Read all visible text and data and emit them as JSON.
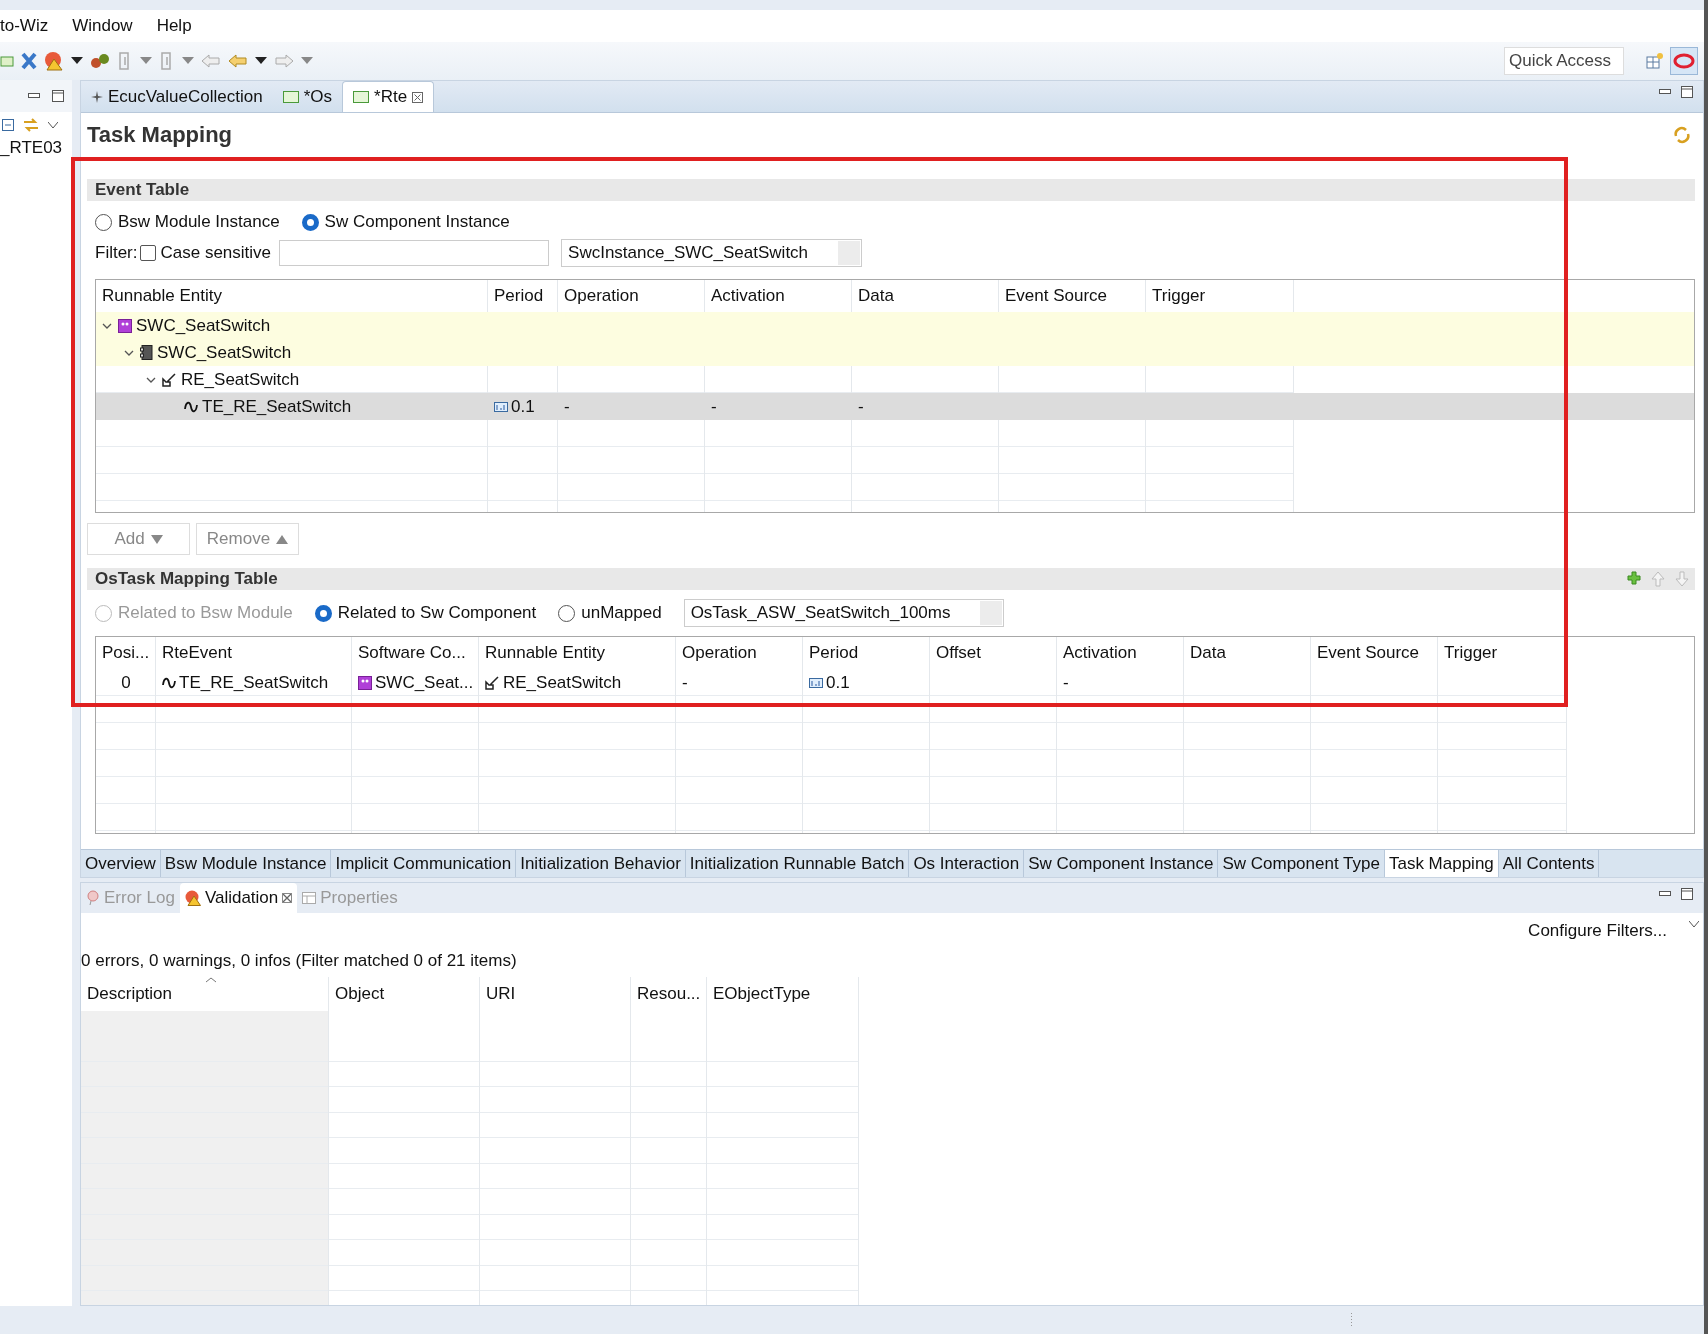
{
  "menu": [
    {
      "label": "to-Wiz"
    },
    {
      "label": "Window"
    },
    {
      "label": "Help"
    }
  ],
  "quick_access": {
    "placeholder": "Quick Access"
  },
  "left_panel": {
    "label": "_RTE03"
  },
  "editor_tabs": [
    {
      "label": "EcucValueCollection",
      "kind": "collection",
      "selected": false
    },
    {
      "label": "*Os",
      "kind": "config",
      "selected": false
    },
    {
      "label": "*Rte",
      "kind": "config",
      "selected": true
    }
  ],
  "page_title": "Task Mapping",
  "event_table": {
    "title": "Event Table",
    "scope": [
      {
        "label": "Bsw Module Instance",
        "selected": false
      },
      {
        "label": "Sw Component Instance",
        "selected": true
      }
    ],
    "filter": {
      "label": "Filter:",
      "case_sensitive": {
        "label": "Case sensitive",
        "checked": false
      }
    },
    "instance": "SwcInstance_SWC_SeatSwitch",
    "columns": [
      "Runnable Entity",
      "Period",
      "Operation",
      "Activation",
      "Data",
      "Event Source",
      "Trigger"
    ],
    "rows": [
      {
        "kind": "component",
        "label": "SWC_SeatSwitch",
        "expanded": true,
        "selected": false,
        "cells": [
          null,
          null,
          null,
          null,
          null,
          null
        ],
        "children": [
          {
            "kind": "swc-type",
            "label": "SWC_SeatSwitch",
            "expanded": true,
            "selected": false,
            "cells": [
              null,
              null,
              null,
              null,
              null,
              null
            ],
            "children": [
              {
                "kind": "runnable",
                "label": "RE_SeatSwitch",
                "expanded": true,
                "selected": false,
                "cells": [
                  null,
                  null,
                  null,
                  null,
                  null,
                  null
                ],
                "children": [
                  {
                    "kind": "timing-event",
                    "label": "TE_RE_SeatSwitch",
                    "selected": true,
                    "cells": [
                      {
                        "text": "0.1",
                        "kind": "period"
                      },
                      {
                        "text": "-"
                      },
                      {
                        "text": "-"
                      },
                      {
                        "text": "-"
                      },
                      null,
                      null
                    ]
                  }
                ]
              }
            ]
          }
        ]
      }
    ],
    "buttons": [
      {
        "label": "Add",
        "kind": "menu-down",
        "disabled": true
      },
      {
        "label": "Remove",
        "kind": "menu-up",
        "disabled": true
      }
    ]
  },
  "ostask_table": {
    "title": "OsTask Mapping Table",
    "scope": [
      {
        "label": "Related to Bsw Module",
        "selected": false,
        "disabled": true
      },
      {
        "label": "Related to Sw Component",
        "selected": true,
        "disabled": false
      },
      {
        "label": "unMapped",
        "selected": false,
        "disabled": false
      }
    ],
    "task": "OsTask_ASW_SeatSwitch_100ms",
    "columns": [
      "Posi...",
      "RteEvent",
      "Software Co...",
      "Runnable Entity",
      "Operation",
      "Period",
      "Offset",
      "Activation",
      "Data",
      "Event Source",
      "Trigger"
    ],
    "rows": [
      {
        "cells": [
          {
            "text": "0"
          },
          {
            "text": "TE_RE_SeatSwitch",
            "kind": "timing-event"
          },
          {
            "text": "SWC_Seat...",
            "kind": "component"
          },
          {
            "text": "RE_SeatSwitch",
            "kind": "runnable"
          },
          {
            "text": "-"
          },
          {
            "text": "0.1",
            "kind": "period"
          },
          null,
          {
            "text": "-"
          },
          null,
          null,
          null
        ]
      }
    ]
  },
  "page_tabs": [
    {
      "label": "Overview",
      "selected": false
    },
    {
      "label": "Bsw Module Instance",
      "selected": false
    },
    {
      "label": "Implicit Communication",
      "selected": false
    },
    {
      "label": "Initialization Behavior",
      "selected": false
    },
    {
      "label": "Initialization Runnable Batch",
      "selected": false
    },
    {
      "label": "Os Interaction",
      "selected": false
    },
    {
      "label": "Sw Component Instance",
      "selected": false
    },
    {
      "label": "Sw Component Type",
      "selected": false
    },
    {
      "label": "Task Mapping",
      "selected": true
    },
    {
      "label": "All Contents",
      "selected": false
    }
  ],
  "views": {
    "tabs": [
      {
        "label": "Error Log",
        "kind": "error-log",
        "selected": false
      },
      {
        "label": "Validation",
        "kind": "validation",
        "selected": true
      },
      {
        "label": "Properties",
        "kind": "properties",
        "selected": false
      }
    ],
    "action": "Configure Filters...",
    "summary": "0 errors, 0 warnings, 0 infos (Filter matched 0 of 21 items)",
    "columns": [
      {
        "label": "Description",
        "sorted": true
      },
      {
        "label": "Object",
        "sorted": false
      },
      {
        "label": "URI",
        "sorted": false
      },
      {
        "label": "Resou...",
        "sorted": false
      },
      {
        "label": "EObjectType",
        "sorted": false
      }
    ]
  }
}
